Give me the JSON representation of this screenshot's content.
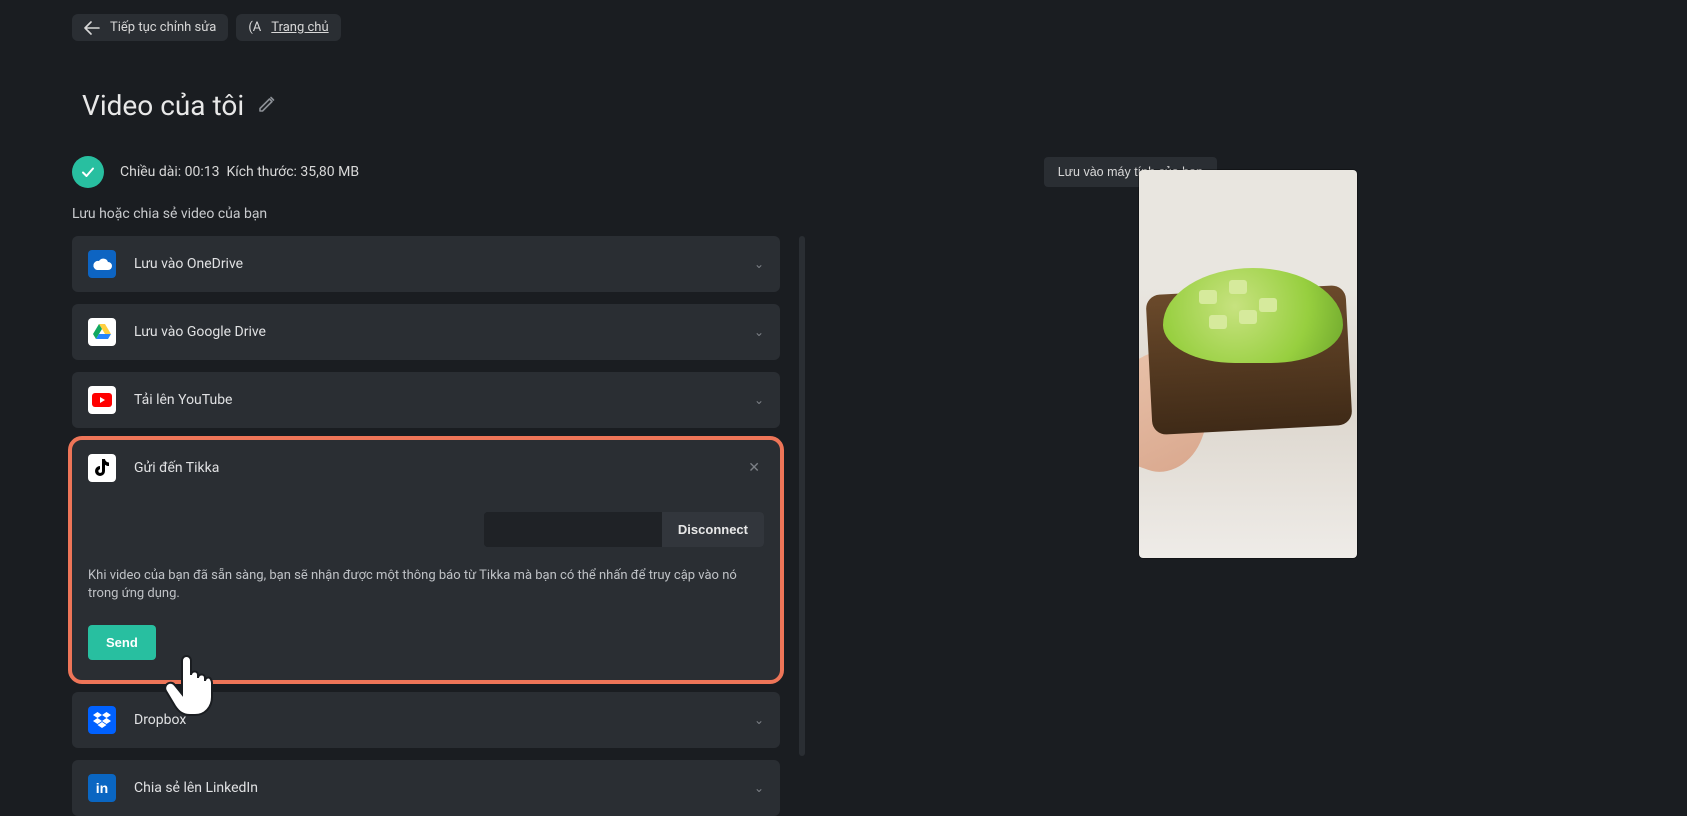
{
  "top": {
    "continue_edit": "Tiếp tục chỉnh sửa",
    "home_prefix": "(A",
    "home_label": "Trang chủ"
  },
  "title": "Video của tôi",
  "status": {
    "length_label": "Chiều dài:",
    "length_value": "00:13",
    "size_label": "Kích thước:",
    "size_value": "35,80 MB",
    "save_local": "Lưu vào máy tính của bạn"
  },
  "section_heading": "Lưu hoặc chia sẻ video của bạn",
  "options": {
    "onedrive": "Lưu vào OneDrive",
    "gdrive": "Lưu vào Google Drive",
    "youtube": "Tải lên YouTube",
    "tiktok": "Gửi đến Tikka",
    "dropbox": "Dropbox",
    "linkedin": "Chia sẻ lên LinkedIn"
  },
  "tiktok": {
    "disconnect": "Disconnect",
    "note": "Khi video của bạn đã sẵn sàng, bạn sẽ nhận được một thông báo từ Tikka mà bạn có thể nhấn để truy cập vào nó trong ứng dụng.",
    "send": "Send"
  },
  "colors": {
    "accent": "#28bfa0",
    "highlight": "#ee7558"
  }
}
